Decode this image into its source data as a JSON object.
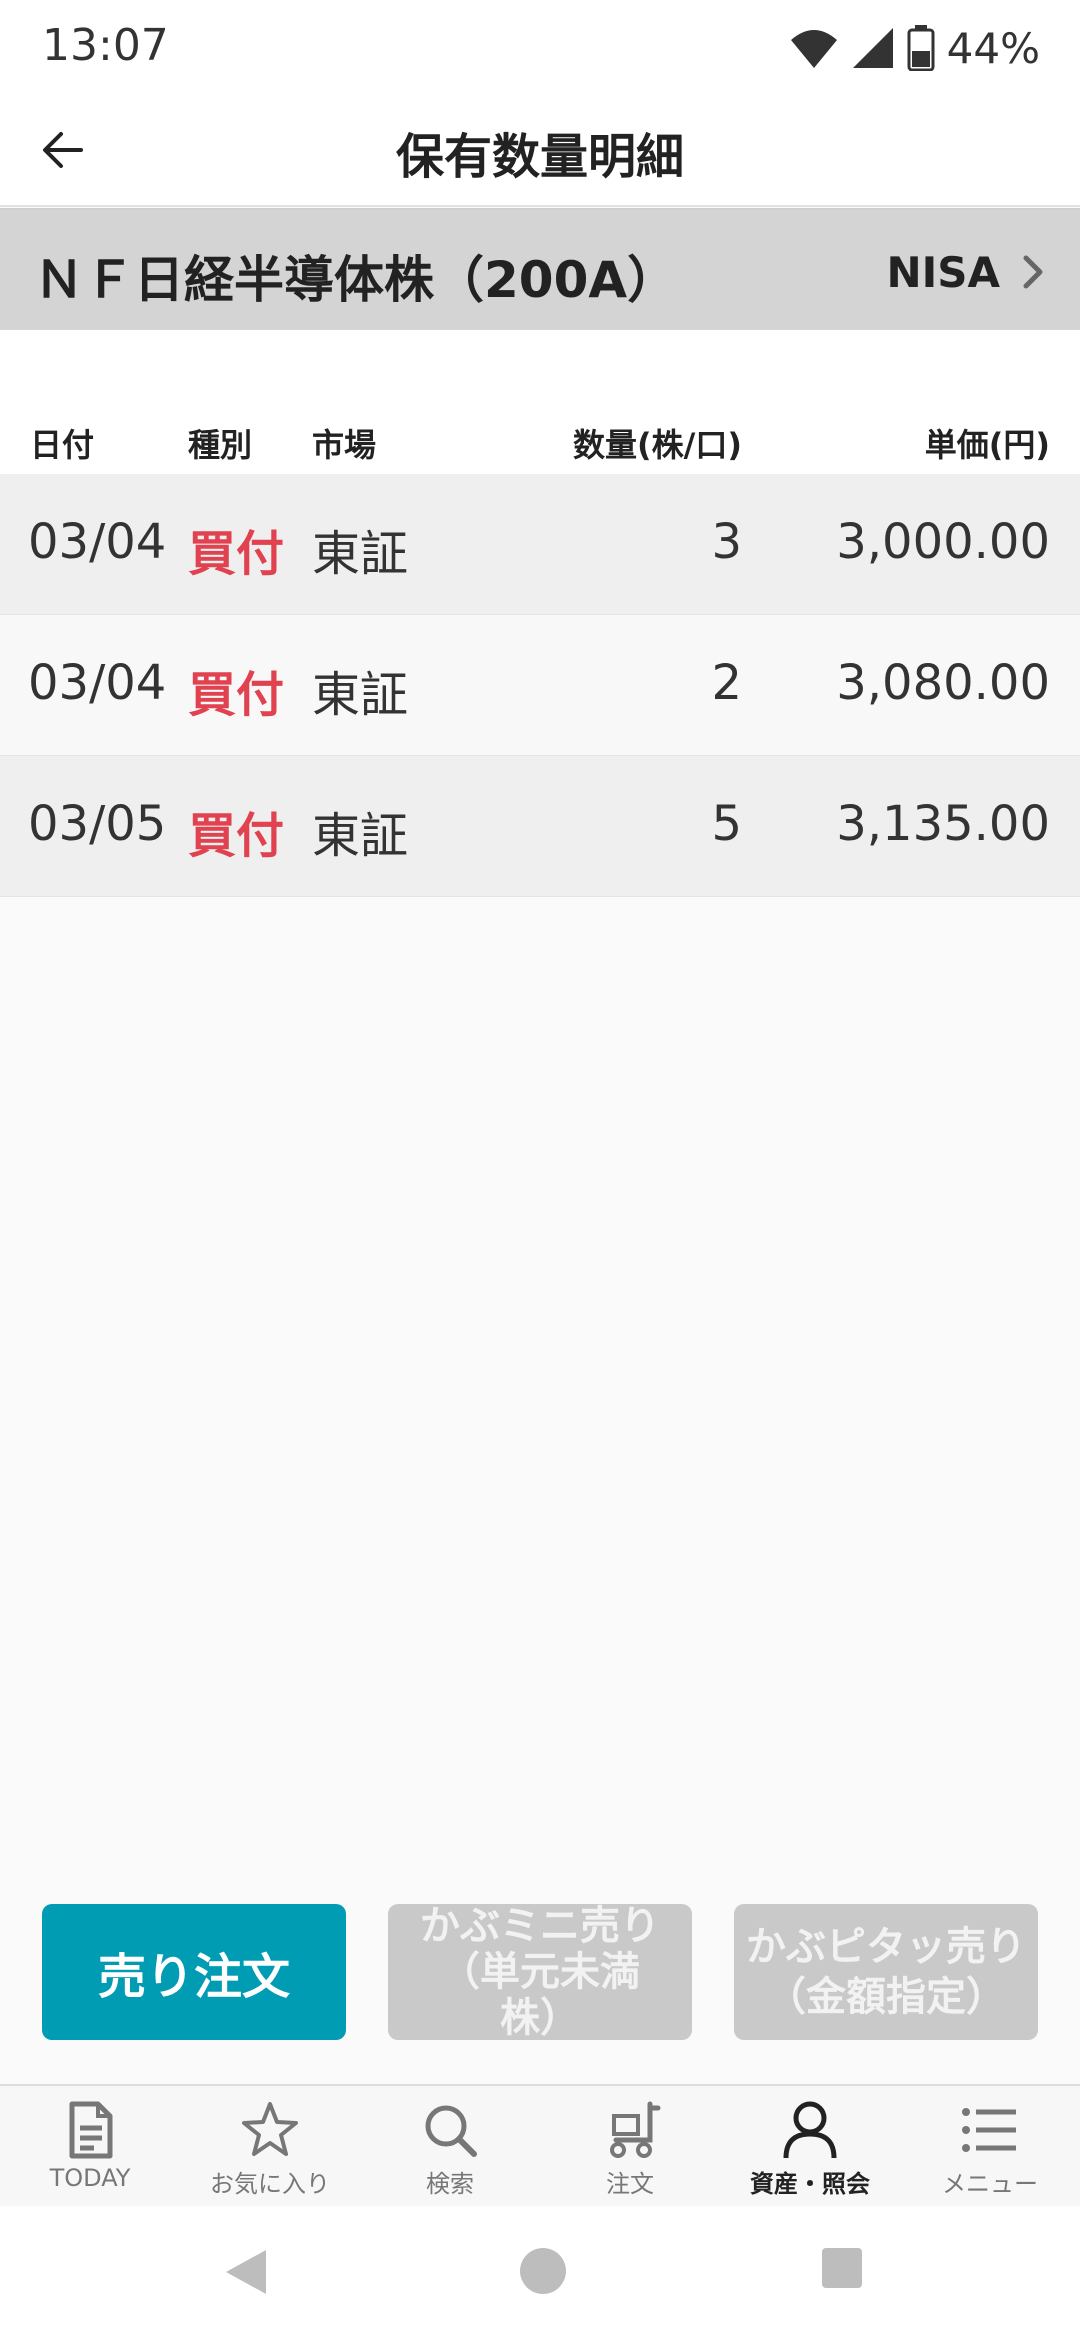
{
  "status": {
    "time": "13:07",
    "battery": "44%"
  },
  "header": {
    "title": "保有数量明細"
  },
  "security": {
    "name": "ＮＦ日経半導体株（200A）",
    "account": "NISA"
  },
  "table": {
    "headers": {
      "date": "日付",
      "type": "種別",
      "market": "市場",
      "qty": "数量(株/口)",
      "price": "単価(円)"
    },
    "rows": [
      {
        "date": "03/04",
        "type": "買付",
        "market": "東証",
        "qty": "3",
        "price": "3,000.00"
      },
      {
        "date": "03/04",
        "type": "買付",
        "market": "東証",
        "qty": "2",
        "price": "3,080.00"
      },
      {
        "date": "03/05",
        "type": "買付",
        "market": "東証",
        "qty": "5",
        "price": "3,135.00"
      }
    ]
  },
  "actions": {
    "sell": "売り注文",
    "mini_sell_line1": "かぶミニ売り",
    "mini_sell_line2": "（単元未満",
    "mini_sell_line3": "株）",
    "pitat_sell_line1": "かぶピタッ売り",
    "pitat_sell_line2": "（金額指定）"
  },
  "nav": {
    "items": [
      {
        "label": "TODAY",
        "icon": "document-icon"
      },
      {
        "label": "お気に入り",
        "icon": "star-icon"
      },
      {
        "label": "検索",
        "icon": "search-icon"
      },
      {
        "label": "注文",
        "icon": "cart-icon"
      },
      {
        "label": "資産・照会",
        "icon": "person-icon"
      },
      {
        "label": "メニュー",
        "icon": "menu-icon"
      }
    ],
    "active_index": 4
  },
  "colors": {
    "accent": "#009cb4",
    "buy_red": "#e0424f",
    "disabled": "#c9c9c9"
  }
}
